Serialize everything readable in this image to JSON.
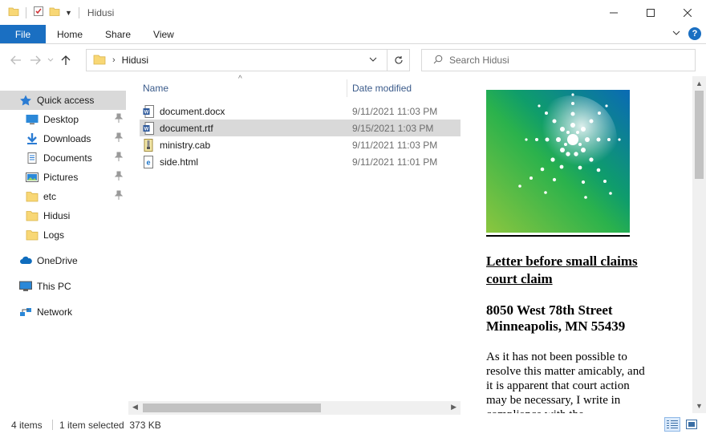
{
  "window": {
    "title": "Hidusi"
  },
  "ribbon": {
    "file": "File",
    "tabs": [
      "Home",
      "Share",
      "View"
    ]
  },
  "address": {
    "path_segment": "Hidusi",
    "search_placeholder": "Search Hidusi"
  },
  "nav": {
    "quick_access": "Quick access",
    "pinned": [
      "Desktop",
      "Downloads",
      "Documents",
      "Pictures",
      "etc"
    ],
    "folders": [
      "Hidusi",
      "Logs"
    ],
    "onedrive": "OneDrive",
    "this_pc": "This PC",
    "network": "Network"
  },
  "columns": {
    "name": "Name",
    "date": "Date modified"
  },
  "files": [
    {
      "name": "document.docx",
      "date": "9/11/2021 11:03 PM",
      "icon": "word-doc-icon"
    },
    {
      "name": "document.rtf",
      "date": "9/15/2021 1:03 PM",
      "icon": "word-rtf-icon"
    },
    {
      "name": "ministry.cab",
      "date": "9/11/2021 11:03 PM",
      "icon": "cab-archive-icon"
    },
    {
      "name": "side.html",
      "date": "9/11/2021 11:01 PM",
      "icon": "html-edge-icon"
    }
  ],
  "preview": {
    "title": "Letter before small claims court claim",
    "address_line1": "8050 West 78th Street",
    "address_line2": "Minneapolis, MN 55439",
    "body": "As it has not been possible to resolve this matter amicably, and it is apparent that court action may be necessary, I write in compliance with the"
  },
  "status": {
    "count": "4 items",
    "selected": "1 item selected  373 KB"
  },
  "colors": {
    "accent": "#1a6fc2",
    "selection": "#d9d9d9",
    "folder": "#f8d775"
  }
}
